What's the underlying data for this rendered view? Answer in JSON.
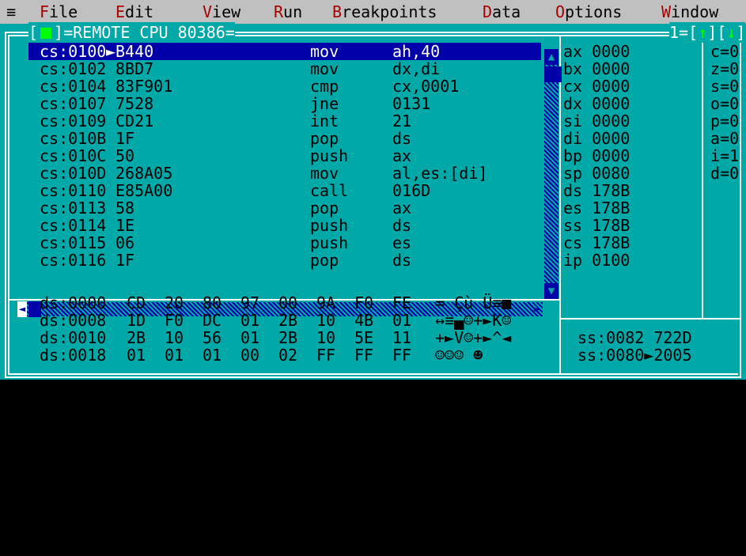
{
  "menu": {
    "system_icon": "≡",
    "items": [
      {
        "hot": "F",
        "rest": "ile"
      },
      {
        "hot": "E",
        "rest": "dit"
      },
      {
        "hot": "V",
        "rest": "iew"
      },
      {
        "hot": "R",
        "rest": "un"
      },
      {
        "hot": "B",
        "rest": "reakpoints"
      },
      {
        "hot": "D",
        "rest": "ata"
      },
      {
        "hot": "O",
        "rest": "ptions"
      },
      {
        "hot": "W",
        "rest": "indow"
      }
    ]
  },
  "window": {
    "close_glyph": "[■]",
    "title": "REMOTE CPU 80386",
    "number": "1",
    "zoom_up": "↑",
    "zoom_down": "↓"
  },
  "code": [
    {
      "addr": "cs:0100",
      "marker": "►",
      "bytes": "B440",
      "mnem": "mov",
      "ops": "ah,40"
    },
    {
      "addr": "cs:0102",
      "marker": " ",
      "bytes": "8BD7",
      "mnem": "mov",
      "ops": "dx,di"
    },
    {
      "addr": "cs:0104",
      "marker": " ",
      "bytes": "83F901",
      "mnem": "cmp",
      "ops": "cx,0001"
    },
    {
      "addr": "cs:0107",
      "marker": " ",
      "bytes": "7528",
      "mnem": "jne",
      "ops": "0131"
    },
    {
      "addr": "cs:0109",
      "marker": " ",
      "bytes": "CD21",
      "mnem": "int",
      "ops": "21"
    },
    {
      "addr": "cs:010B",
      "marker": " ",
      "bytes": "1F",
      "mnem": "pop",
      "ops": "ds"
    },
    {
      "addr": "cs:010C",
      "marker": " ",
      "bytes": "50",
      "mnem": "push",
      "ops": "ax"
    },
    {
      "addr": "cs:010D",
      "marker": " ",
      "bytes": "268A05",
      "mnem": "mov",
      "ops": "al,es:[di]"
    },
    {
      "addr": "cs:0110",
      "marker": " ",
      "bytes": "E85A00",
      "mnem": "call",
      "ops": "016D"
    },
    {
      "addr": "cs:0113",
      "marker": " ",
      "bytes": "58",
      "mnem": "pop",
      "ops": "ax"
    },
    {
      "addr": "cs:0114",
      "marker": " ",
      "bytes": "1E",
      "mnem": "push",
      "ops": "ds"
    },
    {
      "addr": "cs:0115",
      "marker": " ",
      "bytes": "06",
      "mnem": "push",
      "ops": "es"
    },
    {
      "addr": "cs:0116",
      "marker": " ",
      "bytes": "1F",
      "mnem": "pop",
      "ops": "ds"
    }
  ],
  "registers": [
    {
      "name": "ax",
      "value": "0000"
    },
    {
      "name": "bx",
      "value": "0000"
    },
    {
      "name": "cx",
      "value": "0000"
    },
    {
      "name": "dx",
      "value": "0000"
    },
    {
      "name": "si",
      "value": "0000"
    },
    {
      "name": "di",
      "value": "0000"
    },
    {
      "name": "bp",
      "value": "0000"
    },
    {
      "name": "sp",
      "value": "0080"
    },
    {
      "name": "ds",
      "value": "178B"
    },
    {
      "name": "es",
      "value": "178B"
    },
    {
      "name": "ss",
      "value": "178B"
    },
    {
      "name": "cs",
      "value": "178B"
    },
    {
      "name": "ip",
      "value": "0100"
    }
  ],
  "flags": [
    "c=0",
    "z=0",
    "s=0",
    "o=0",
    "p=0",
    "a=0",
    "i=1",
    "d=0"
  ],
  "dump": [
    {
      "addr": "ds:0000",
      "bytes": [
        "CD",
        "20",
        "80",
        "97",
        "00",
        "9A",
        "F0",
        "FE"
      ],
      "ascii": "= Çù Ü≡■"
    },
    {
      "addr": "ds:0008",
      "bytes": [
        "1D",
        "F0",
        "DC",
        "01",
        "2B",
        "10",
        "4B",
        "01"
      ],
      "ascii": "↔≡▄☺+►K☺"
    },
    {
      "addr": "ds:0010",
      "bytes": [
        "2B",
        "10",
        "56",
        "01",
        "2B",
        "10",
        "5E",
        "11"
      ],
      "ascii": "+►V☺+►^◄"
    },
    {
      "addr": "ds:0018",
      "bytes": [
        "01",
        "01",
        "01",
        "00",
        "02",
        "FF",
        "FF",
        "FF"
      ],
      "ascii": "☺☺☺ ☻"
    }
  ],
  "stack": [
    {
      "addr": "ss:0082",
      "marker": " ",
      "value": "722D"
    },
    {
      "addr": "ss:0080",
      "marker": "►",
      "value": "2005"
    }
  ],
  "colors": {
    "menu_bg": "#c0c0c0",
    "menu_hotkey": "#a80000",
    "window_bg": "#00a8a8",
    "selection_bg": "#0000a8",
    "frame": "#ffffff",
    "active_glyph": "#00ff00"
  }
}
